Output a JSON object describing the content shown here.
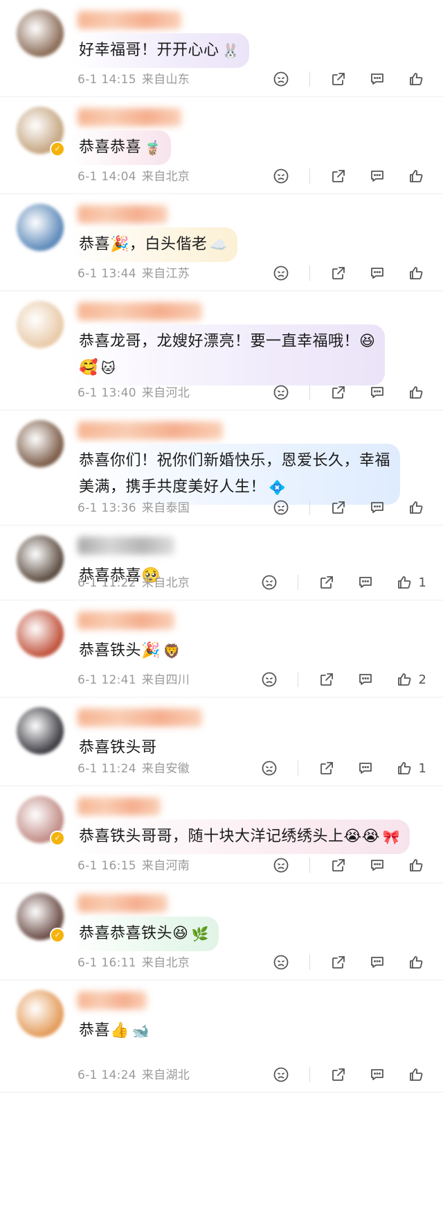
{
  "comments": [
    {
      "text": "好幸福哥！开开心心",
      "date": "6-1 14:15",
      "location": "来自山东",
      "likes": "",
      "bubble": "purple",
      "avatar": "#8a6a55",
      "verified": false,
      "deco": "🐰"
    },
    {
      "text": "恭喜恭喜",
      "date": "6-1 14:04",
      "location": "来自北京",
      "likes": "",
      "bubble": "pink",
      "avatar": "#c4a47f",
      "verified": true,
      "deco": "🧋"
    },
    {
      "text": "恭喜🎉，白头偕老",
      "date": "6-1 13:44",
      "location": "来自江苏",
      "likes": "",
      "bubble": "yellow",
      "avatar": "#5a87b8",
      "verified": false,
      "deco": "☁️"
    },
    {
      "text": "恭喜龙哥，龙嫂好漂亮！要一直幸福哦！😆",
      "text2": "🥰",
      "date": "6-1 13:40",
      "location": "来自河北",
      "likes": "",
      "bubble": "purple",
      "avatar": "#e8c9a7",
      "verified": false,
      "deco": "🐱"
    },
    {
      "text": "恭喜你们！祝你们新婚快乐，恩爱长久，幸福",
      "text2": "美满，携手共度美好人生！",
      "date": "6-1 13:36",
      "location": "来自泰国",
      "likes": "",
      "bubble": "blue",
      "avatar": "#7a5a45",
      "verified": false,
      "deco": "💠"
    },
    {
      "text": "恭喜恭喜🥺",
      "date": "6-1 11:22",
      "location": "来自北京",
      "likes": "1",
      "bubble": "plain",
      "avatar": "#5a4a3e",
      "verified": false,
      "deco": ""
    },
    {
      "text": "恭喜铁头🎉",
      "date": "6-1 12:41",
      "location": "来自四川",
      "likes": "2",
      "bubble": "plain",
      "avatar": "#c0503a",
      "verified": false,
      "deco": "🦁"
    },
    {
      "text": "恭喜铁头哥",
      "date": "6-1 11:24",
      "location": "来自安徽",
      "likes": "1",
      "bubble": "plain",
      "avatar": "#3a3a40",
      "verified": false,
      "deco": ""
    },
    {
      "text": "恭喜铁头哥哥，随十块大洋记绣绣头上😭😭",
      "date": "6-1 16:15",
      "location": "来自河南",
      "likes": "",
      "bubble": "pink",
      "avatar": "#c08a84",
      "verified": true,
      "deco": "🎀"
    },
    {
      "text": "恭喜恭喜铁头😆",
      "date": "6-1 16:11",
      "location": "来自北京",
      "likes": "",
      "bubble": "green",
      "avatar": "#6a4a44",
      "verified": true,
      "deco": "🌿"
    },
    {
      "text": "恭喜👍",
      "date": "6-1 14:24",
      "location": "来自湖北",
      "likes": "",
      "bubble": "plain",
      "avatar": "#e39a57",
      "verified": false,
      "deco": "🐋"
    }
  ]
}
